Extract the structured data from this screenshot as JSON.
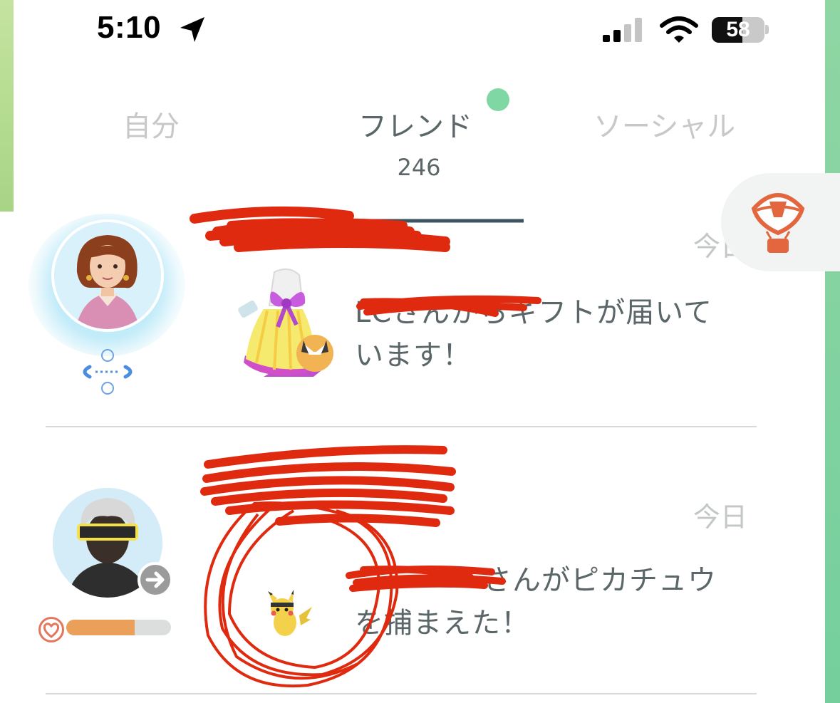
{
  "status_bar": {
    "time": "5:10",
    "battery_level": "58",
    "battery_fraction": 0.58,
    "icons": [
      "location-arrow-icon",
      "cellular-signal-icon",
      "wifi-icon",
      "battery-icon"
    ]
  },
  "tabs": [
    {
      "label": "自分",
      "active": false
    },
    {
      "label": "フレンド",
      "active": true,
      "has_notification_dot": true
    },
    {
      "label": "ソーシャル",
      "active": false
    }
  ],
  "friend_count": "246",
  "friends": [
    {
      "name": "",
      "time": "今日",
      "message_name": "LC",
      "message": "さんからギフトが届いています！",
      "item_icon": "gift-icon",
      "status_icon": "trade-icon"
    },
    {
      "name": "",
      "time": "今日",
      "message_name": "",
      "message": "さんがピカチュウを捕まえた！",
      "item_icon": "pikachu-icon",
      "friendship_progress": 0.65
    }
  ],
  "balloon_button_icon": "team-rocket-balloon-icon",
  "colors": {
    "active_tab": "#5b6668",
    "inactive_tab": "#c7c9c9",
    "notification_dot": "#7fd7a3",
    "accent_orange": "#e4765e",
    "progress_fill": "#eba05a",
    "redaction": "#e02a10"
  }
}
